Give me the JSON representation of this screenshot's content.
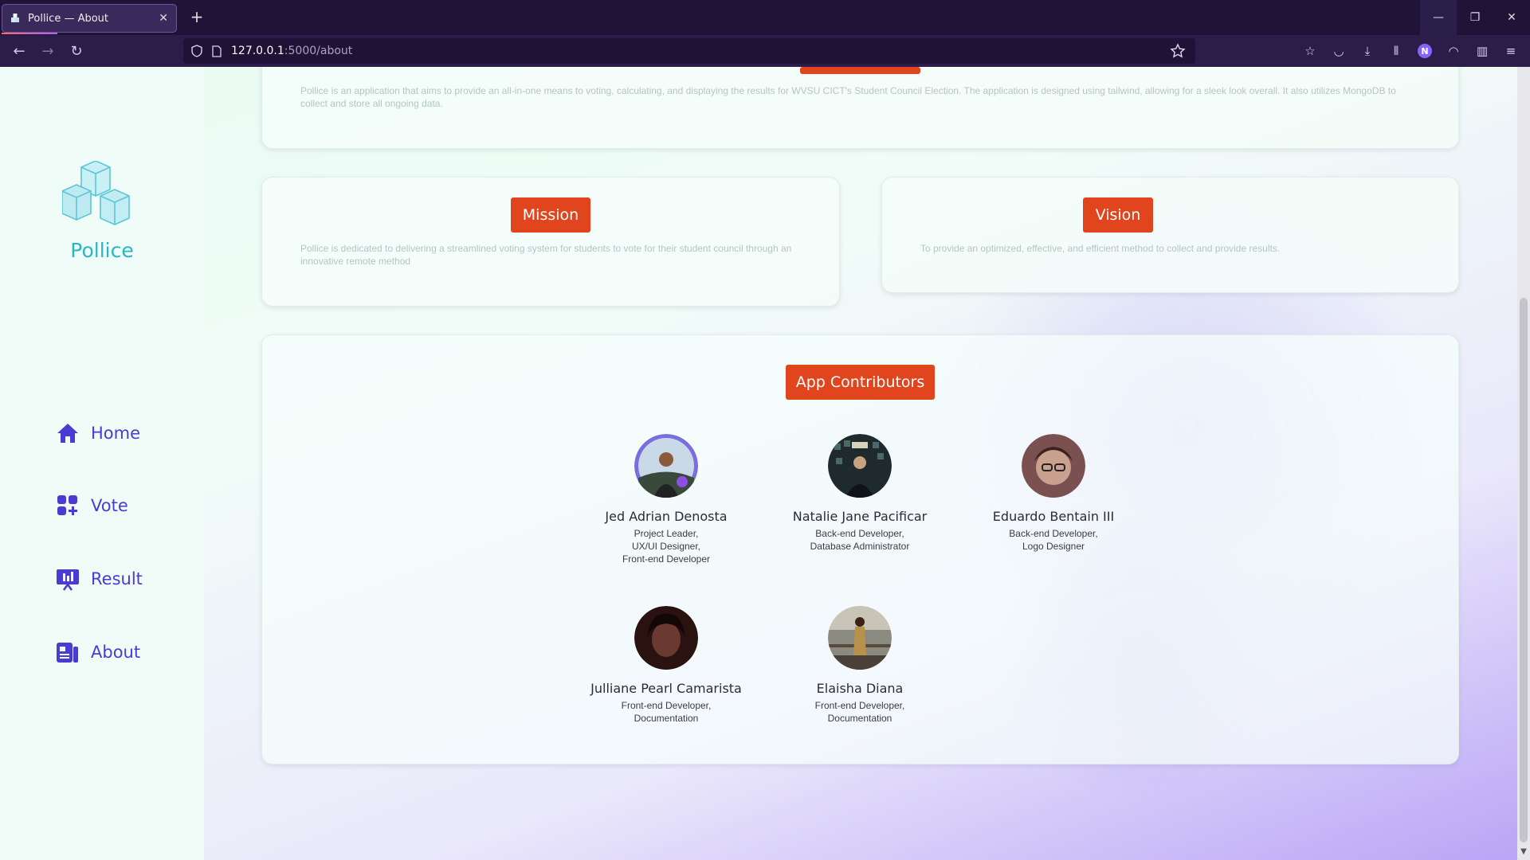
{
  "browser": {
    "tab_title": "Pollice — About",
    "url_host": "127.0.0.1",
    "url_rest": ":5000/about",
    "profile_initial": "N"
  },
  "sidebar": {
    "brand": "Pollice",
    "items": [
      {
        "label": "Home",
        "icon": "home-icon"
      },
      {
        "label": "Vote",
        "icon": "vote-icon"
      },
      {
        "label": "Result",
        "icon": "result-icon"
      },
      {
        "label": "About",
        "icon": "about-icon"
      }
    ]
  },
  "about": {
    "text": "Pollice is an application that aims to provide an all-in-one means to voting, calculating, and displaying the results for WVSU CICT's Student Council Election. The application is designed using tailwind, allowing for a sleek look overall. It also utilizes MongoDB to collect and store all ongoing data."
  },
  "mission": {
    "label": "Mission",
    "text": "Pollice is dedicated to delivering a streamlined voting system for students to vote for their student council through an innovative remote method"
  },
  "vision": {
    "label": "Vision",
    "text": "To provide an optimized, effective, and efficient method to collect and provide results."
  },
  "contributors": {
    "label": "App Contributors",
    "members": [
      {
        "name": "Jed Adrian Denosta",
        "role": "Project Leader,\nUX/UI Designer,\nFront-end Developer"
      },
      {
        "name": "Natalie Jane Pacificar",
        "role": "Back-end Developer,\nDatabase Administrator"
      },
      {
        "name": "Eduardo Bentain III",
        "role": "Back-end Developer,\nLogo Designer"
      },
      {
        "name": "Julliane Pearl Camarista",
        "role": "Front-end Developer,\nDocumentation"
      },
      {
        "name": "Elaisha Diana",
        "role": "Front-end Developer,\nDocumentation"
      }
    ]
  },
  "colors": {
    "accent": "#e0451e",
    "nav": "#4a3bd3",
    "brand": "#2bb6c4"
  }
}
